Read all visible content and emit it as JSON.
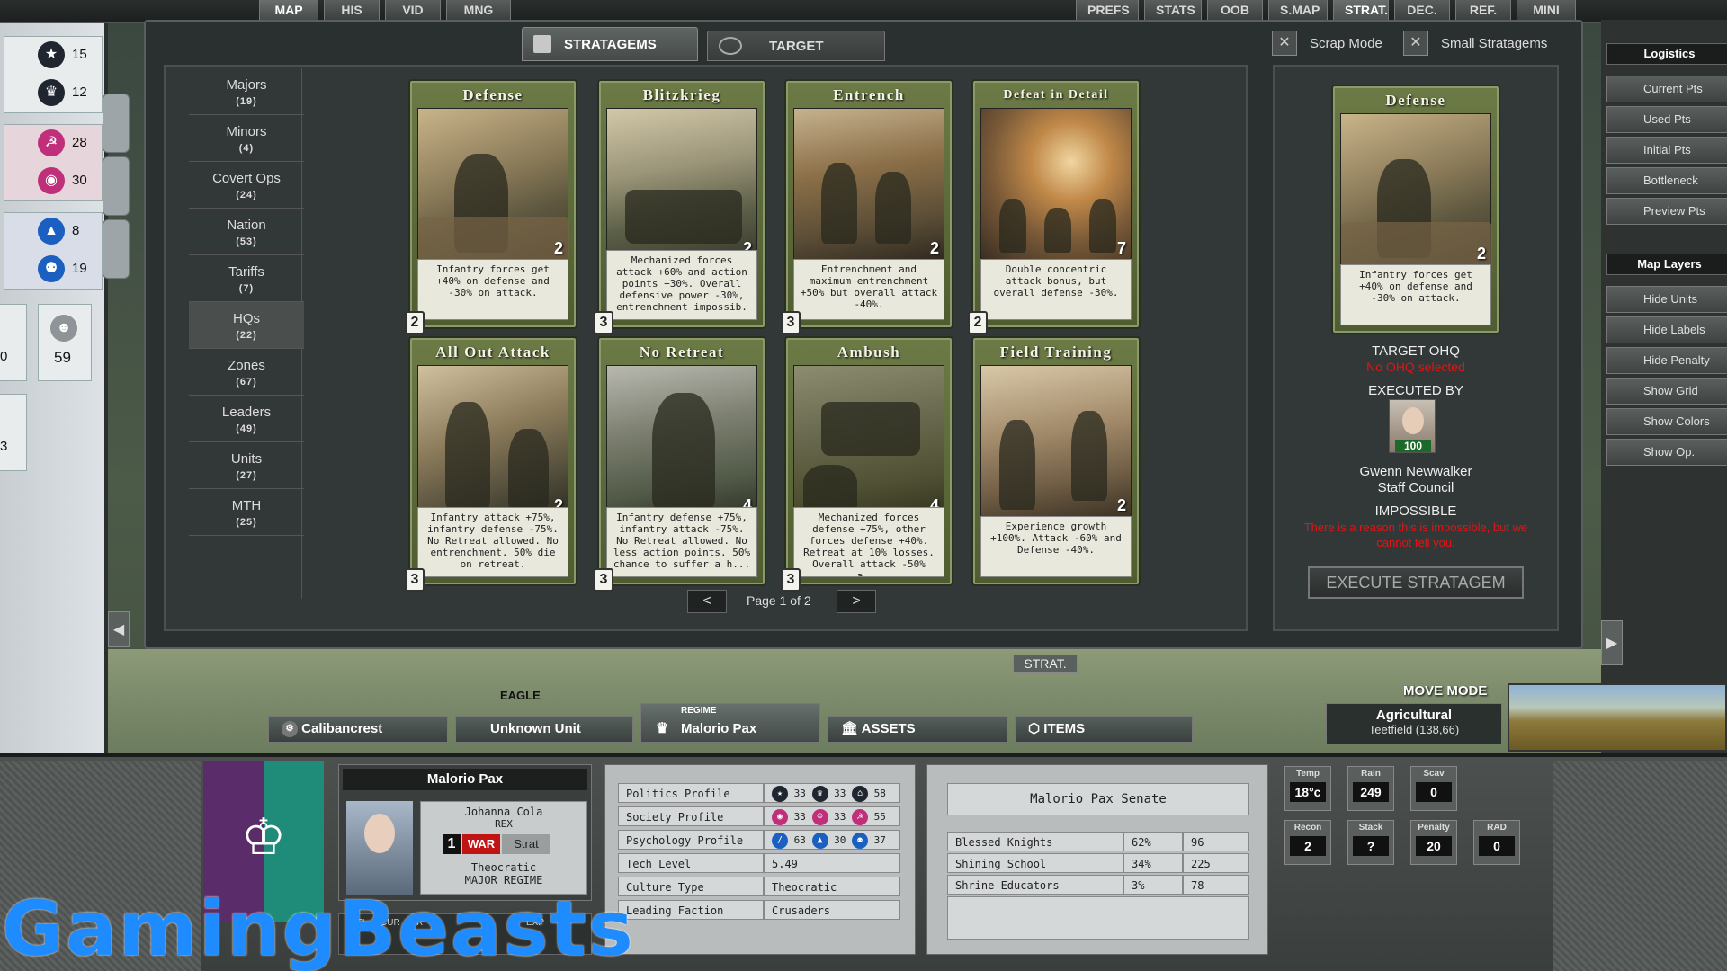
{
  "topbar": {
    "tabs": [
      "MAP",
      "HIS",
      "VID",
      "MNG",
      "PREFS",
      "STATS",
      "OOB",
      "S.MAP",
      "STRAT.",
      "DEC.",
      "REF.",
      "MINI"
    ]
  },
  "left_strip": {
    "items": [
      {
        "icon": "star-icon",
        "value": "15"
      },
      {
        "icon": "crown-icon",
        "value": "12"
      },
      {
        "icon": "hammer-sickle-icon",
        "value": "28"
      },
      {
        "icon": "eye-icon",
        "value": "30"
      },
      {
        "icon": "graduation-cap-icon",
        "value": "8"
      },
      {
        "icon": "people-icon",
        "value": "19"
      }
    ],
    "box_a_value": "0",
    "box_b_value": "59",
    "box_c_value": "3"
  },
  "tabs": {
    "stratagems": "STRATAGEMS",
    "target": "TARGET",
    "scrap_mode": "Scrap Mode",
    "small_stratagems": "Small Stratagems"
  },
  "categories": [
    {
      "name": "Majors",
      "count": "(19)"
    },
    {
      "name": "Minors",
      "count": "(4)"
    },
    {
      "name": "Covert Ops",
      "count": "(24)"
    },
    {
      "name": "Nation",
      "count": "(53)"
    },
    {
      "name": "Tariffs",
      "count": "(7)"
    },
    {
      "name": "HQs",
      "count": "(22)"
    },
    {
      "name": "Zones",
      "count": "(67)"
    },
    {
      "name": "Leaders",
      "count": "(49)"
    },
    {
      "name": "Units",
      "count": "(27)"
    },
    {
      "name": "MTH",
      "count": "(25)"
    }
  ],
  "cards": [
    {
      "title": "Defense",
      "cost": "2",
      "level": "2",
      "desc": "Infantry forces get +40% on defense and -30% on attack."
    },
    {
      "title": "Blitzkrieg",
      "cost": "2",
      "level": "3",
      "desc": "Mechanized forces attack +60% and action points +30%. Overall defensive power -30%, entrenchment impossib."
    },
    {
      "title": "Entrench",
      "cost": "2",
      "level": "3",
      "desc": "Entrenchment and maximum entrenchment +50% but overall attack -40%."
    },
    {
      "title": "Defeat in Detail",
      "cost": "7",
      "level": "2",
      "desc": "Double concentric attack bonus, but overall defense -30%."
    },
    {
      "title": "All Out Attack",
      "cost": "2",
      "level": "3",
      "desc": "Infantry attack +75%, infantry defense -75%. No Retreat allowed. No entrenchment. 50% die on retreat."
    },
    {
      "title": "No Retreat",
      "cost": "4",
      "level": "3",
      "desc": "Infantry defense +75%, infantry attack -75%. No Retreat allowed. No less action points. 50% chance to suffer a h..."
    },
    {
      "title": "Ambush",
      "cost": "4",
      "level": "3",
      "desc": "Mechanized forces defense +75%, other forces defense +40%. Retreat at 10% losses. Overall attack -50% a..."
    },
    {
      "title": "Field Training",
      "cost": "2",
      "level": "",
      "desc": "Experience growth +100%. Attack -60% and Defense -40%."
    }
  ],
  "pager": {
    "prev": "<",
    "label": "Page 1 of 2",
    "next": ">"
  },
  "detail": {
    "card_title": "Defense",
    "card_cost": "2",
    "card_desc": "Infantry forces get +40% on defense and -30% on attack.",
    "target_label": "TARGET OHQ",
    "target_value": "No OHQ selected",
    "executed_label": "EXECUTED BY",
    "executor_level": "100",
    "executor_name": "Gwenn Newwalker",
    "executor_role": "Staff Council",
    "status": "IMPOSSIBLE",
    "status_reason": "There is a reason this is impossible, but we cannot tell you.",
    "execute_button": "EXECUTE STRATAGEM"
  },
  "right_panel": {
    "logistics_header": "Logistics",
    "logistics_items": [
      "Current Pts",
      "Used Pts",
      "Initial Pts",
      "Bottleneck",
      "Preview Pts"
    ],
    "map_layers_header": "Map Layers",
    "map_layers_items": [
      "Hide Units",
      "Hide Labels",
      "Hide Penalty",
      "Show Grid",
      "Show Colors",
      "Show Op."
    ]
  },
  "map_strip": {
    "strat_label": "STRAT.",
    "eagle_label": "EAGLE",
    "move_mode": "MOVE MODE",
    "terrain_type": "Agricultural",
    "terrain_loc": "Teetfield (138,66)"
  },
  "bottom_tabs": {
    "calibancrest": "Calibancrest",
    "unknown_unit": "Unknown Unit",
    "regime_small": "REGIME",
    "regime_name": "Malorio Pax",
    "assets": "ASSETS",
    "items": "ITEMS"
  },
  "regime": {
    "name": "Malorio Pax",
    "leader": "Johanna Cola",
    "leader_title": "REX",
    "war_num": "1",
    "war_label": "WAR",
    "strat_label": "Strat",
    "gov_type": "Theocratic",
    "regime_class": "MAJOR REGIME",
    "mini_tabs": [
      "REL",
      "CUR",
      "R",
      "",
      "",
      "EXP"
    ]
  },
  "profile": {
    "rows": [
      {
        "label": "Politics Profile",
        "icons": [
          {
            "icon": "star-icon",
            "v": "33"
          },
          {
            "icon": "crown-icon",
            "v": "33"
          },
          {
            "icon": "bank-icon",
            "v": "58"
          }
        ]
      },
      {
        "label": "Society Profile",
        "icons": [
          {
            "icon": "eye-icon",
            "v": "33"
          },
          {
            "icon": "mask-icon",
            "v": "33"
          },
          {
            "icon": "hammer-sickle-icon",
            "v": "55"
          }
        ]
      },
      {
        "label": "Psychology Profile",
        "icons": [
          {
            "icon": "sword-icon",
            "v": "63"
          },
          {
            "icon": "graduation-cap-icon",
            "v": "30"
          },
          {
            "icon": "people-icon",
            "v": "37"
          }
        ]
      }
    ],
    "tech_label": "Tech Level",
    "tech_value": "5.49",
    "culture_label": "Culture Type",
    "culture_value": "Theocratic",
    "faction_label": "Leading Faction",
    "faction_value": "Crusaders"
  },
  "senate": {
    "title": "Malorio Pax Senate",
    "rows": [
      {
        "name": "Blessed Knights",
        "pct": "62%",
        "seats": "96"
      },
      {
        "name": "Shining School",
        "pct": "34%",
        "seats": "225"
      },
      {
        "name": "Shrine Educators",
        "pct": "3%",
        "seats": "78"
      }
    ]
  },
  "hex_stats": [
    {
      "label": "Temp",
      "value": "18°c"
    },
    {
      "label": "Rain",
      "value": "249"
    },
    {
      "label": "Scav",
      "value": "0"
    },
    {
      "label": "Recon",
      "value": "2"
    },
    {
      "label": "Stack",
      "value": "?"
    },
    {
      "label": "Penalty",
      "value": "20"
    },
    {
      "label": "RAD",
      "value": "0"
    }
  ],
  "watermark": "GamingBeasts",
  "colors": {
    "accent_red": "#e01515",
    "watermark_blue": "#1e8cff",
    "card_green": "#5d6b3a"
  }
}
